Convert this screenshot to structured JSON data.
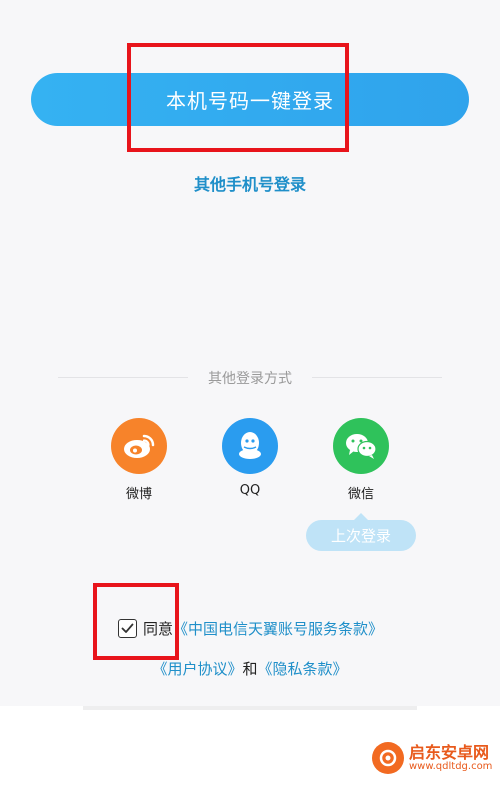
{
  "login": {
    "one_click_label": "本机号码一键登录",
    "other_phone_label": "其他手机号登录"
  },
  "divider": {
    "text": "其他登录方式"
  },
  "social": [
    {
      "label": "微博",
      "icon": "weibo-icon",
      "color": "#f7832a"
    },
    {
      "label": "QQ",
      "icon": "qq-icon",
      "color": "#2a9cef"
    },
    {
      "label": "微信",
      "icon": "wechat-icon",
      "color": "#2fc25b"
    }
  ],
  "last_login_tip": "上次登录",
  "agreement": {
    "checked": true,
    "prefix": "同意",
    "telecom_terms": "《中国电信天翼账号服务条款》",
    "user_agreement": "《用户协议》",
    "and": "和",
    "privacy": "《隐私条款》"
  },
  "watermark": {
    "title": "启东安卓网",
    "url": "www.qdltdg.com"
  },
  "colors": {
    "accent": "#2fa3ec",
    "link": "#1f8fc9",
    "highlight": "#e8141b"
  }
}
